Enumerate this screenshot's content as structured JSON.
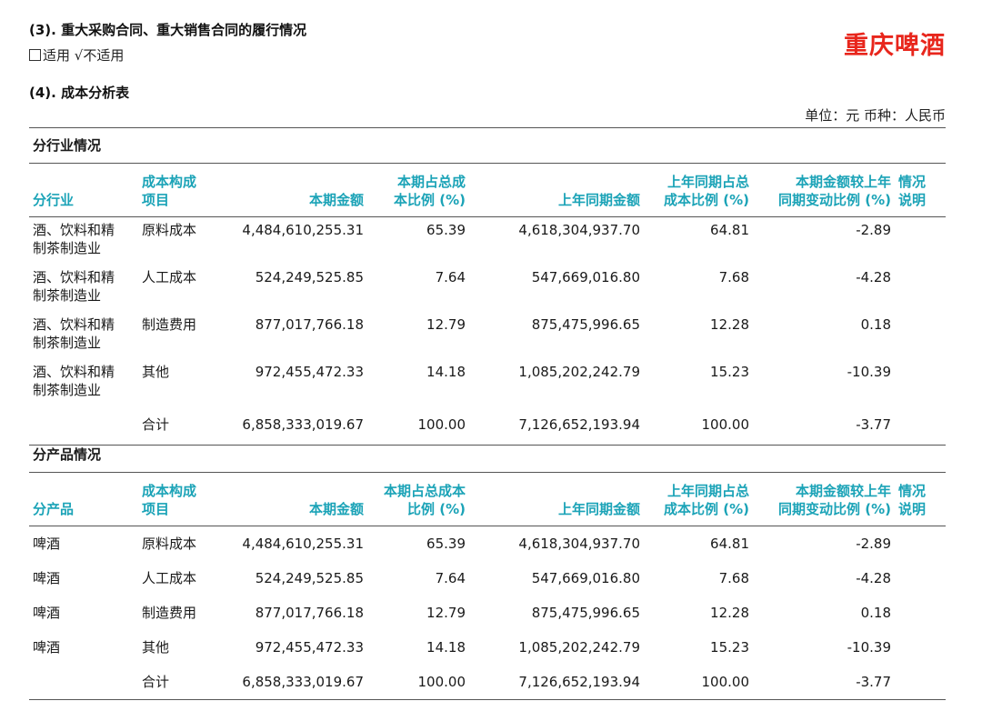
{
  "header": {
    "section3_title": "(3). 重大采购合同、重大销售合同的履行情况",
    "applicability_prefix": "适用",
    "applicability_check": "√",
    "applicability_suffix": "不适用",
    "section4_title": "(4). 成本分析表",
    "brand": "重庆啤酒",
    "unit": "单位：元  币种：人民币"
  },
  "industry": {
    "title": "分行业情况",
    "headers": {
      "c1": "分行业",
      "c2": [
        "成本构成",
        "项目"
      ],
      "c3": "本期金额",
      "c4": [
        "本期占总成",
        "本比例 (%)"
      ],
      "c5": "上年同期金额",
      "c6": [
        "上年同期占总",
        "成本比例 (%)"
      ],
      "c7": [
        "本期金额较上年",
        "同期变动比例 (%)"
      ],
      "c8": [
        "情况",
        "说明"
      ]
    },
    "rows": [
      {
        "segment": [
          "酒、饮料和精",
          "制茶制造业"
        ],
        "item": "原料成本",
        "current": "4,484,610,255.31",
        "cur_pct": "65.39",
        "prior": "4,618,304,937.70",
        "prior_pct": "64.81",
        "change": "-2.89"
      },
      {
        "segment": [
          "酒、饮料和精",
          "制茶制造业"
        ],
        "item": "人工成本",
        "current": "524,249,525.85",
        "cur_pct": "7.64",
        "prior": "547,669,016.80",
        "prior_pct": "7.68",
        "change": "-4.28"
      },
      {
        "segment": [
          "酒、饮料和精",
          "制茶制造业"
        ],
        "item": "制造费用",
        "current": "877,017,766.18",
        "cur_pct": "12.79",
        "prior": "875,475,996.65",
        "prior_pct": "12.28",
        "change": "0.18"
      },
      {
        "segment": [
          "酒、饮料和精",
          "制茶制造业"
        ],
        "item": "其他",
        "current": "972,455,472.33",
        "cur_pct": "14.18",
        "prior": "1,085,202,242.79",
        "prior_pct": "15.23",
        "change": "-10.39"
      },
      {
        "segment": [
          "",
          ""
        ],
        "item": "合计",
        "current": "6,858,333,019.67",
        "cur_pct": "100.00",
        "prior": "7,126,652,193.94",
        "prior_pct": "100.00",
        "change": "-3.77"
      }
    ]
  },
  "product": {
    "title": "分产品情况",
    "headers": {
      "c1": "分产品",
      "c2": [
        "成本构成",
        "项目"
      ],
      "c3": "本期金额",
      "c4": [
        "本期占总成本",
        "比例 (%)"
      ],
      "c5": "上年同期金额",
      "c6": [
        "上年同期占总",
        "成本比例 (%)"
      ],
      "c7": [
        "本期金额较上年",
        "同期变动比例 (%)"
      ],
      "c8": [
        "情况",
        "说明"
      ]
    },
    "rows": [
      {
        "segment": "啤酒",
        "item": "原料成本",
        "current": "4,484,610,255.31",
        "cur_pct": "65.39",
        "prior": "4,618,304,937.70",
        "prior_pct": "64.81",
        "change": "-2.89"
      },
      {
        "segment": "啤酒",
        "item": "人工成本",
        "current": "524,249,525.85",
        "cur_pct": "7.64",
        "prior": "547,669,016.80",
        "prior_pct": "7.68",
        "change": "-4.28"
      },
      {
        "segment": "啤酒",
        "item": "制造费用",
        "current": "877,017,766.18",
        "cur_pct": "12.79",
        "prior": "875,475,996.65",
        "prior_pct": "12.28",
        "change": "0.18"
      },
      {
        "segment": "啤酒",
        "item": "其他",
        "current": "972,455,472.33",
        "cur_pct": "14.18",
        "prior": "1,085,202,242.79",
        "prior_pct": "15.23",
        "change": "-10.39"
      },
      {
        "segment": "",
        "item": "合计",
        "current": "6,858,333,019.67",
        "cur_pct": "100.00",
        "prior": "7,126,652,193.94",
        "prior_pct": "100.00",
        "change": "-3.77"
      }
    ]
  },
  "colors": {
    "header_text": "#1ba3b7",
    "brand": "#e8261c"
  }
}
